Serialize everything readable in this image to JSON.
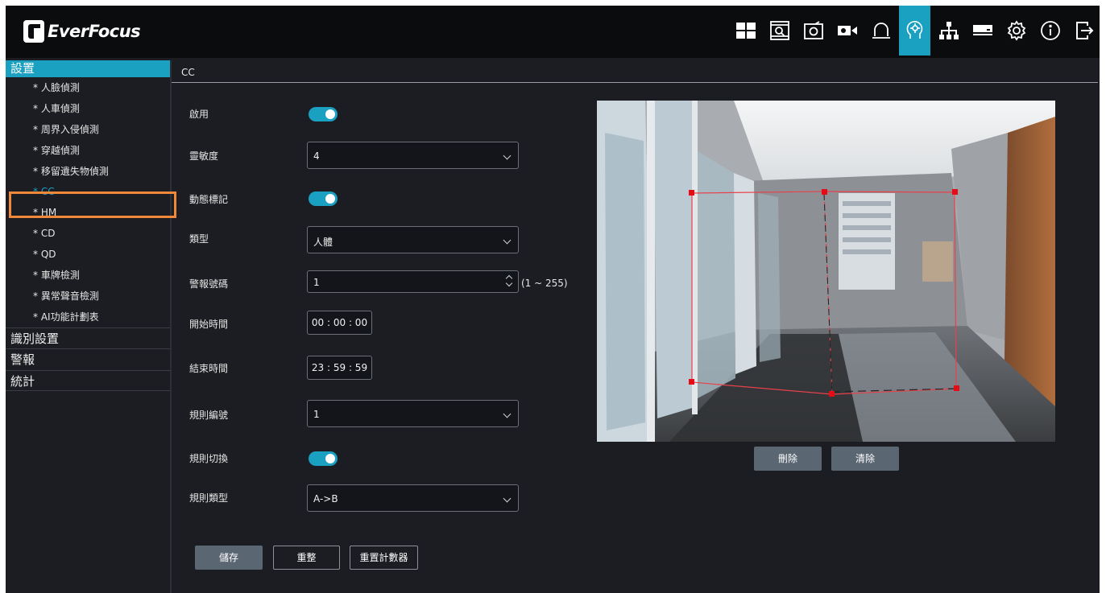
{
  "brand": {
    "name": "EverFocus"
  },
  "topbar": {
    "icons": [
      {
        "name": "live-view-grid-icon",
        "active": false
      },
      {
        "name": "playback-icon",
        "active": false
      },
      {
        "name": "snapshot-icon",
        "active": false
      },
      {
        "name": "record-icon",
        "active": false
      },
      {
        "name": "alarm-bell-icon",
        "active": false
      },
      {
        "name": "ai-brain-icon",
        "active": true
      },
      {
        "name": "network-icon",
        "active": false
      },
      {
        "name": "storage-icon",
        "active": false
      },
      {
        "name": "settings-gear-icon",
        "active": false
      },
      {
        "name": "info-icon",
        "active": false
      },
      {
        "name": "logout-icon",
        "active": false
      }
    ],
    "accent_color": "#1aa0c0"
  },
  "sidebar": {
    "header": "設置",
    "items": [
      "* 人臉偵測",
      "* 人車偵測",
      "* 周界入侵偵測",
      "* 穿越偵測",
      "* 移留遺失物偵測",
      "* CC",
      "* HM",
      "* CD",
      "* QD",
      "* 車牌檢測",
      "* 異常聲音檢測",
      "* AI功能計劃表"
    ],
    "active_index": 5,
    "groups": [
      "識別設置",
      "警報",
      "統計"
    ]
  },
  "main": {
    "title": "CC",
    "fields": {
      "enable_label": "啟用",
      "enable_value": true,
      "sensitivity_label": "靈敏度",
      "sensitivity_value": "4",
      "dynamic_mark_label": "動態標記",
      "dynamic_mark_value": true,
      "type_label": "類型",
      "type_value": "人體",
      "alarm_no_label": "警報號碼",
      "alarm_no_value": "1",
      "alarm_no_range": "(1 ~ 255)",
      "start_time_label": "開始時間",
      "start_time_value": "00 : 00 : 00",
      "end_time_label": "結束時間",
      "end_time_value": "23 : 59 : 59",
      "rule_no_label": "規則編號",
      "rule_no_value": "1",
      "rule_switch_label": "規則切換",
      "rule_switch_value": true,
      "rule_type_label": "規則類型",
      "rule_type_value": "A->B"
    },
    "buttons": {
      "save": "儲存",
      "reset": "重整",
      "reset_counter": "重置計數器",
      "delete": "刪除",
      "clear": "清除"
    }
  }
}
